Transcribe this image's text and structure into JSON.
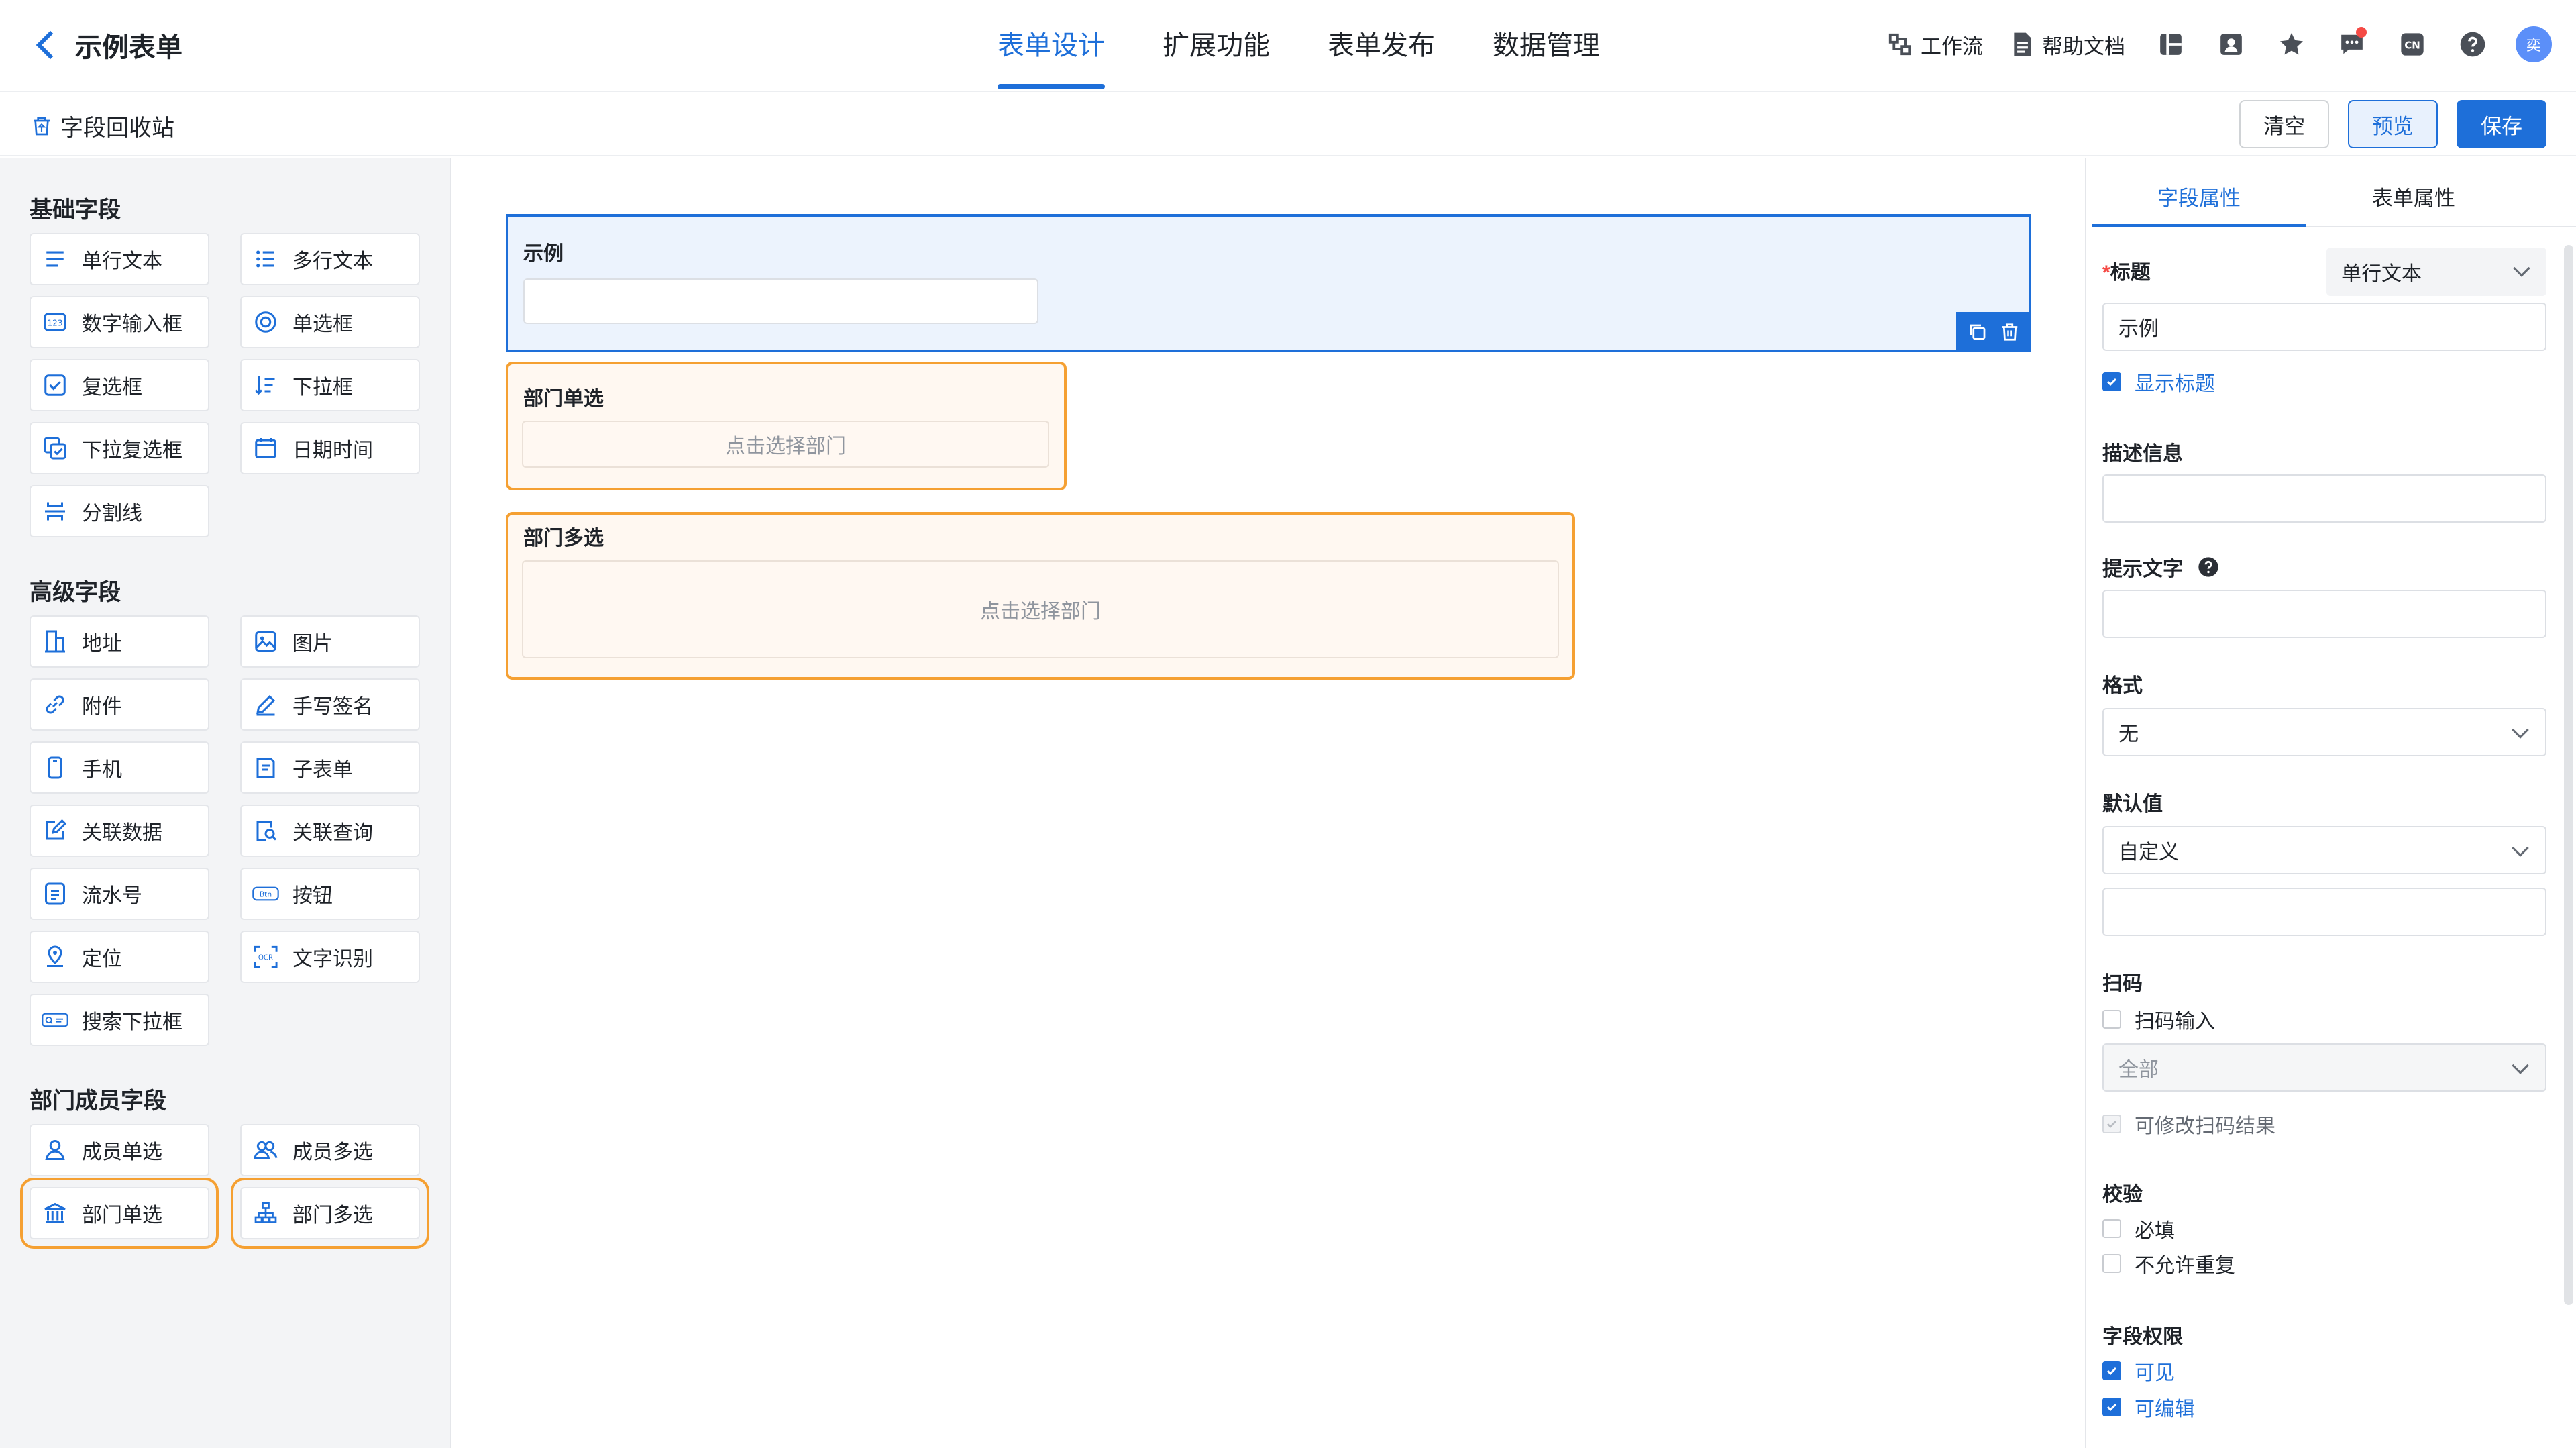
{
  "header": {
    "back_title": "示例表单",
    "tabs": [
      {
        "label": "表单设计"
      },
      {
        "label": "扩展功能"
      },
      {
        "label": "表单发布"
      },
      {
        "label": "数据管理"
      }
    ],
    "workflow_label": "工作流",
    "help_label": "帮助文档",
    "lang_label": "CN",
    "avatar_text": "奕"
  },
  "subbar": {
    "recycle_label": "字段回收站",
    "clear_label": "清空",
    "preview_label": "预览",
    "save_label": "保存"
  },
  "left": {
    "basic_title": "基础字段",
    "basic": [
      {
        "label": "单行文本",
        "icon": "align-lines-icon"
      },
      {
        "label": "多行文本",
        "icon": "list-lines-icon"
      },
      {
        "label": "数字输入框",
        "icon": "number-123-icon"
      },
      {
        "label": "单选框",
        "icon": "radio-icon"
      },
      {
        "label": "复选框",
        "icon": "checkbox-icon"
      },
      {
        "label": "下拉框",
        "icon": "sort-list-icon"
      },
      {
        "label": "下拉复选框",
        "icon": "multi-select-icon"
      },
      {
        "label": "日期时间",
        "icon": "calendar-icon"
      },
      {
        "label": "分割线",
        "icon": "divider-icon"
      }
    ],
    "advanced_title": "高级字段",
    "advanced": [
      {
        "label": "地址",
        "icon": "building-icon"
      },
      {
        "label": "图片",
        "icon": "image-icon"
      },
      {
        "label": "附件",
        "icon": "link-icon"
      },
      {
        "label": "手写签名",
        "icon": "pen-icon"
      },
      {
        "label": "手机",
        "icon": "phone-icon"
      },
      {
        "label": "子表单",
        "icon": "subform-icon"
      },
      {
        "label": "关联数据",
        "icon": "link-edit-icon"
      },
      {
        "label": "关联查询",
        "icon": "search-doc-icon"
      },
      {
        "label": "流水号",
        "icon": "serial-icon"
      },
      {
        "label": "按钮",
        "icon": "button-icon"
      },
      {
        "label": "定位",
        "icon": "location-icon"
      },
      {
        "label": "文字识别",
        "icon": "ocr-icon"
      },
      {
        "label": "搜索下拉框",
        "icon": "search-select-icon"
      }
    ],
    "dept_title": "部门成员字段",
    "dept": [
      {
        "label": "成员单选",
        "icon": "user-icon"
      },
      {
        "label": "成员多选",
        "icon": "users-icon"
      },
      {
        "label": "部门单选",
        "icon": "bank-icon"
      },
      {
        "label": "部门多选",
        "icon": "org-tree-icon"
      }
    ],
    "btn_icon_text": "Btn",
    "ocr_icon_text": "OCR"
  },
  "canvas": {
    "example_label": "示例",
    "dept_single_label": "部门单选",
    "dept_single_placeholder": "点击选择部门",
    "dept_multi_label": "部门多选",
    "dept_multi_placeholder": "点击选择部门"
  },
  "right": {
    "tabs": [
      {
        "label": "字段属性"
      },
      {
        "label": "表单属性"
      }
    ],
    "title_label": "标题",
    "field_type_value": "单行文本",
    "title_value": "示例",
    "show_title_label": "显示标题",
    "desc_label": "描述信息",
    "hint_label": "提示文字",
    "format_label": "格式",
    "format_value": "无",
    "default_label": "默认值",
    "default_value": "自定义",
    "scan_label": "扫码",
    "scan_input_label": "扫码输入",
    "scan_select_value": "全部",
    "scan_editable_label": "可修改扫码结果",
    "validate_label": "校验",
    "required_label": "必填",
    "no_dup_label": "不允许重复",
    "perm_label": "字段权限",
    "visible_label": "可见",
    "editable_label": "可编辑"
  },
  "colors": {
    "primary": "#1e6fd9",
    "highlight": "#f5a032",
    "danger": "#f54a45"
  }
}
